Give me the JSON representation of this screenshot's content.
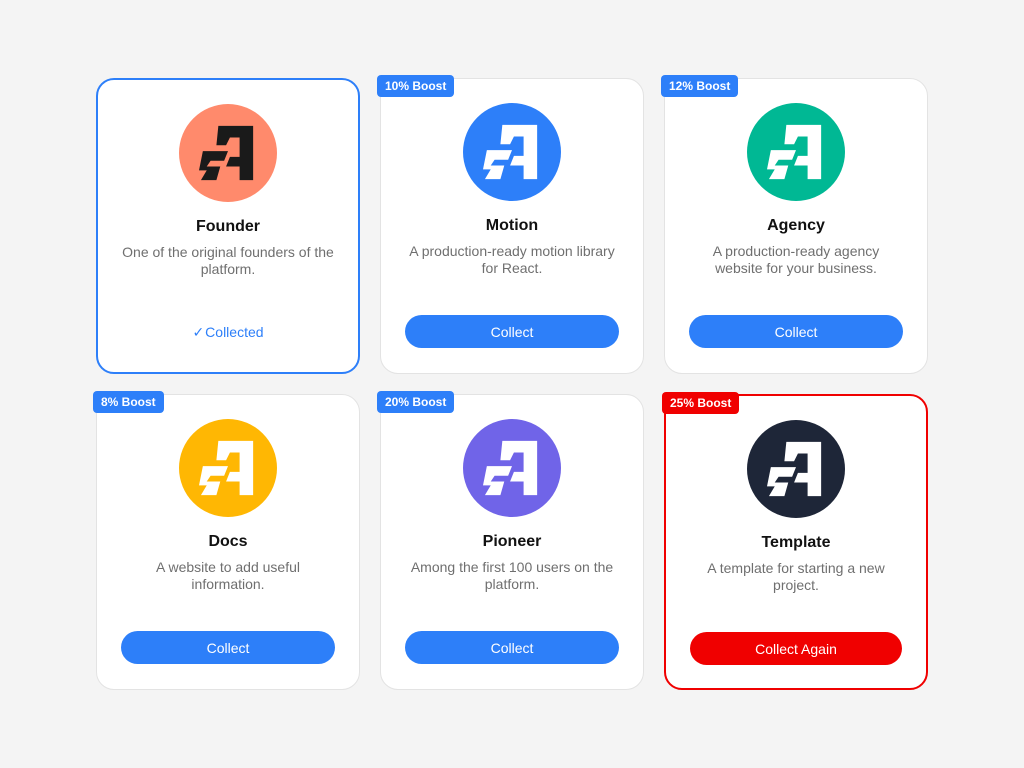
{
  "colors": {
    "accent": "#2d7ff9",
    "danger": "#f00000",
    "logo_founder": "#ff8a6c",
    "logo_motion": "#2d7ff9",
    "logo_agency": "#00b894",
    "logo_docs": "#ffb703",
    "logo_pioneer": "#7064e8",
    "logo_template": "#1e2638"
  },
  "cards": [
    {
      "title": "Founder",
      "description": "One of the original founders of the platform.",
      "status": "Collected",
      "check_icon": "✓",
      "logo_icon": "a-logo-icon"
    },
    {
      "badge": "10% Boost",
      "title": "Motion",
      "description": "A production-ready motion library for React.",
      "button": "Collect",
      "logo_icon": "a-logo-icon"
    },
    {
      "badge": "12% Boost",
      "title": "Agency",
      "description": "A production-ready agency website for your business.",
      "button": "Collect",
      "logo_icon": "a-logo-icon"
    },
    {
      "badge": "8% Boost",
      "title": "Docs",
      "description": "A website to add useful information.",
      "button": "Collect",
      "logo_icon": "a-logo-icon"
    },
    {
      "badge": "20% Boost",
      "title": "Pioneer",
      "description": "Among the first 100 users on the platform.",
      "button": "Collect",
      "logo_icon": "a-logo-icon"
    },
    {
      "badge": "25% Boost",
      "title": "Template",
      "description": "A template for starting a new project.",
      "button": "Collect Again",
      "logo_icon": "a-logo-icon"
    }
  ]
}
